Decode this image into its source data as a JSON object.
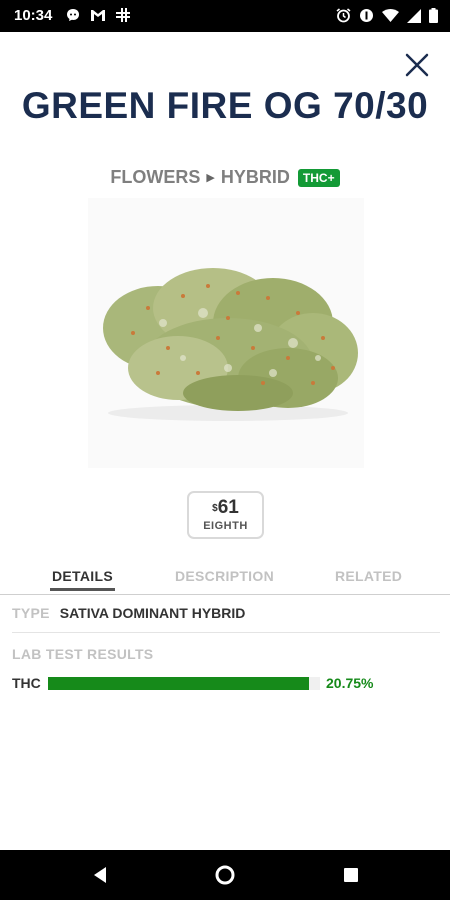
{
  "status_bar": {
    "time": "10:34",
    "left_icons": [
      "chat-bubble-icon",
      "gmail-icon",
      "slack-icon"
    ],
    "right_icons": [
      "alarm-icon",
      "do-not-disturb-icon",
      "wifi-icon",
      "signal-icon",
      "battery-icon"
    ]
  },
  "header": {
    "close_icon": "close-icon",
    "title": "GREEN FIRE OG 70/30",
    "breadcrumb": {
      "category": "FLOWERS",
      "separator_icon": "triangle-right-icon",
      "subcategory": "HYBRID",
      "badge": "THC+"
    }
  },
  "price": {
    "currency": "$",
    "amount": "61",
    "unit": "EIGHTH"
  },
  "tabs": [
    {
      "label": "DETAILS",
      "active": true
    },
    {
      "label": "DESCRIPTION",
      "active": false
    },
    {
      "label": "RELATED",
      "active": false
    }
  ],
  "details": {
    "type_label": "TYPE",
    "type_value": "SATIVA DOMINANT HYBRID",
    "lab_heading": "LAB TEST RESULTS",
    "thc_label": "THC",
    "thc_value": "20.75%",
    "thc_fill_fraction": 0.96
  },
  "colors": {
    "title": "#1b2d4f",
    "badge": "#139a36",
    "thc_bar": "#168a1a"
  },
  "nav_bar": {
    "icons": [
      "back-icon",
      "home-icon",
      "recents-icon"
    ]
  }
}
